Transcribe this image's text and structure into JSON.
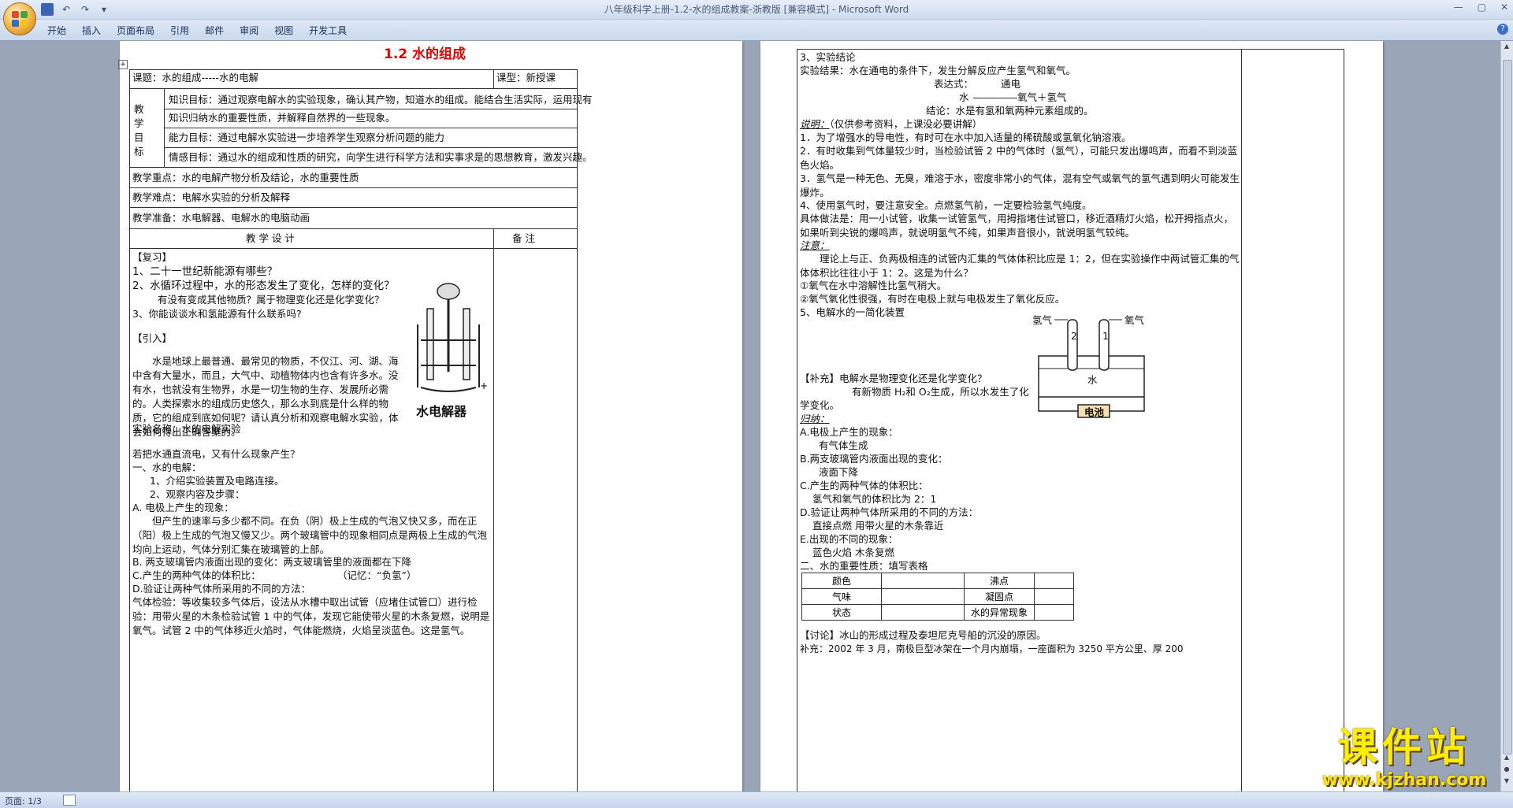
{
  "window": {
    "title": "八年级科学上册-1.2-水的组成教案-浙教版 [兼容模式] - Microsoft Word"
  },
  "ribbon": {
    "tabs": [
      "开始",
      "插入",
      "页面布局",
      "引用",
      "邮件",
      "审阅",
      "视图",
      "开发工具"
    ]
  },
  "status": {
    "page": "页面: 1/3"
  },
  "watermark": {
    "big": "课件站",
    "url": "www.kjzhan.com"
  },
  "page1": {
    "title": "1.2 水的组成",
    "topic": "课题：水的组成-----水的电解",
    "type": "课型：新授课",
    "goals_label": [
      "教",
      "学",
      "目",
      "标"
    ],
    "goal1": "知识目标：通过观察电解水的实验现象，确认其产物，知道水的组成。能结合生活实际，运用现有",
    "goal2": "知识归纳水的重要性质，并解释自然界的一些现象。",
    "goal3": "能力目标：通过电解水实验进一步培养学生观察分析问题的能力",
    "goal4": "情感目标：通过水的组成和性质的研究，向学生进行科学方法和实事求是的思想教育，激发兴趣。",
    "key": "教学重点：水的电解产物分析及结论，水的重要性质",
    "difficulty": "教学难点：电解水实验的分析及解释",
    "prep": "教学准备：水电解器、电解水的电脑动画",
    "design": "教 学 设 计",
    "notes": "备  注",
    "review": "【复习】",
    "q1": "1、二十一世纪新能源有哪些？",
    "q2": "2、水循环过程中，水的形态发生了变化，怎样的变化？",
    "q2b": "有没有变成其他物质？属于物理变化还是化学变化？",
    "q3": "3、你能谈谈水和氢能源有什么联系吗?",
    "intro": "【引入】",
    "para1": "水是地球上最普通、最常见的物质，不仅江、河、湖、海中含有大量水，而且，大气中、动植物体内也含有许多水。没有水，也就没有生物界，水是一切生物的生存、发展所必需的。人类探索水的组成历史悠久，那么水到底是什么样的物质，它的组成到底如何呢？请认真分析和观察电解水实验，体会如何得出正确答案的。",
    "exp_name": "实验名称：水的电解实验",
    "device_label": "水电解器",
    "question": "若把水通直流电，又有什么现象产生？",
    "s1": "一、水的电解：",
    "s1a": "1、介绍实验装置及电路连接。",
    "s1b": "2、观察内容及步骤：",
    "A": "A.   电极上产生的现象：",
    "A_text": "但产生的速率与多少都不同。在负（阴）极上生成的气泡又快又多，而在正（阳）极上生成的气泡又慢又少。两个玻璃管中的现象相同点是两极上生成的气泡均向上运动，气体分别汇集在玻璃管的上部。",
    "B": "B.   两支玻璃管内液面出现的变化：两支玻璃管里的液面都在下降",
    "C": "C.产生的两种气体的体积比：",
    "C_note": "（记忆：“负氢”）",
    "D": "D.验证让两种气体所采用的不同的方法：",
    "D_text": "气体检验：等收集较多气体后，设法从水槽中取出试管（应堵住试管口）进行检验：用带火星的木条检验试管 1 中的气体，发现它能使带火星的木条复燃，说明是氧气。试管 2 中的气体移近火焰时，气体能燃烧，火焰呈淡蓝色。这是氢气。"
  },
  "page2": {
    "c3": "3、实验结论",
    "result": "实验结果：水在通电的条件下，发生分解反应产生氢气和氧气。",
    "formula_label": "表达式：",
    "condition": "通电",
    "reactant": "水",
    "products": "氧气＋氢气",
    "conclusion": "结论：水是有氢和氧两种元素组成的。",
    "explain_head": "说明：",
    "explain_tail": "（仅供参考资料，上课没必要讲解）",
    "e1": "1．为了增强水的导电性，有时可在水中加入适量的稀硫酸或氢氧化钠溶液。",
    "e2": "2．有时收集到气体量较少时，当检验试管 2 中的气体时（氢气），可能只发出爆鸣声，而看不到淡蓝色火焰。",
    "e3": "3．氢气是一种无色、无臭，难溶于水，密度非常小的气体，混有空气或氧气的氢气遇到明火可能发生爆炸。",
    "e4": "4、使用氢气时，要注意安全。点燃氢气前，一定要检验氢气纯度。",
    "method": "具体做法是：用一小试管，收集一试管氢气，用拇指堵住试管口，移近酒精灯火焰，松开拇指点火，如果听到尖锐的爆鸣声，就说明氢气不纯，如果声音很小，就说明氢气较纯。",
    "attn": "注意：",
    "attn_text": "理论上与正、负两极相连的试管内汇集的气体体积比应是 1：2，但在实验操作中两试管汇集的气体体积比往往小于 1：2。这是为什么？",
    "r1": "①氧气在水中溶解性比氢气稍大。",
    "r2": "②氧气氧化性很强，有时在电极上就与电极发生了氧化反应。",
    "s5": "5、电解水的一简化装置",
    "h2": "氢气",
    "o2": "氧气",
    "tube2": "2",
    "tube1": "1",
    "water": "水",
    "battery": "电池",
    "supp": "【补充】电解水是物理变化还是化学变化？",
    "supp_text": "有新物质 H₂和 O₂生成，所以水发生了化",
    "supp_text2": "学变化。",
    "summary": "归纳：",
    "a": "A.电极上产生的现象：",
    "a1": "有气体生成",
    "b": "B.两支玻璃管内液面出现的变化：",
    "b1": "液面下降",
    "c": "C.产生的两种气体的体积比：",
    "c1": "氢气和氧气的体积比为 2：1",
    "d": "D.验证让两种气体所采用的不同的方法：",
    "d1": "直接点燃      用带火星的木条靠近",
    "e": "E.出现的不同的现象：",
    "e_1": "蓝色火焰        木条复燃",
    "two": "二、水的重要性质：填写表格",
    "table": [
      [
        "颜色",
        "",
        "沸点",
        ""
      ],
      [
        "气味",
        "",
        "凝固点",
        ""
      ],
      [
        "状态",
        "",
        "水的异常现象",
        ""
      ]
    ],
    "discuss": "【讨论】冰山的形成过程及泰坦尼克号船的沉没的原因。",
    "add": "补充：2002 年 3 月，南极巨型冰架在一个月内崩塌，一座面积为 3250 平方公里、厚 200"
  }
}
